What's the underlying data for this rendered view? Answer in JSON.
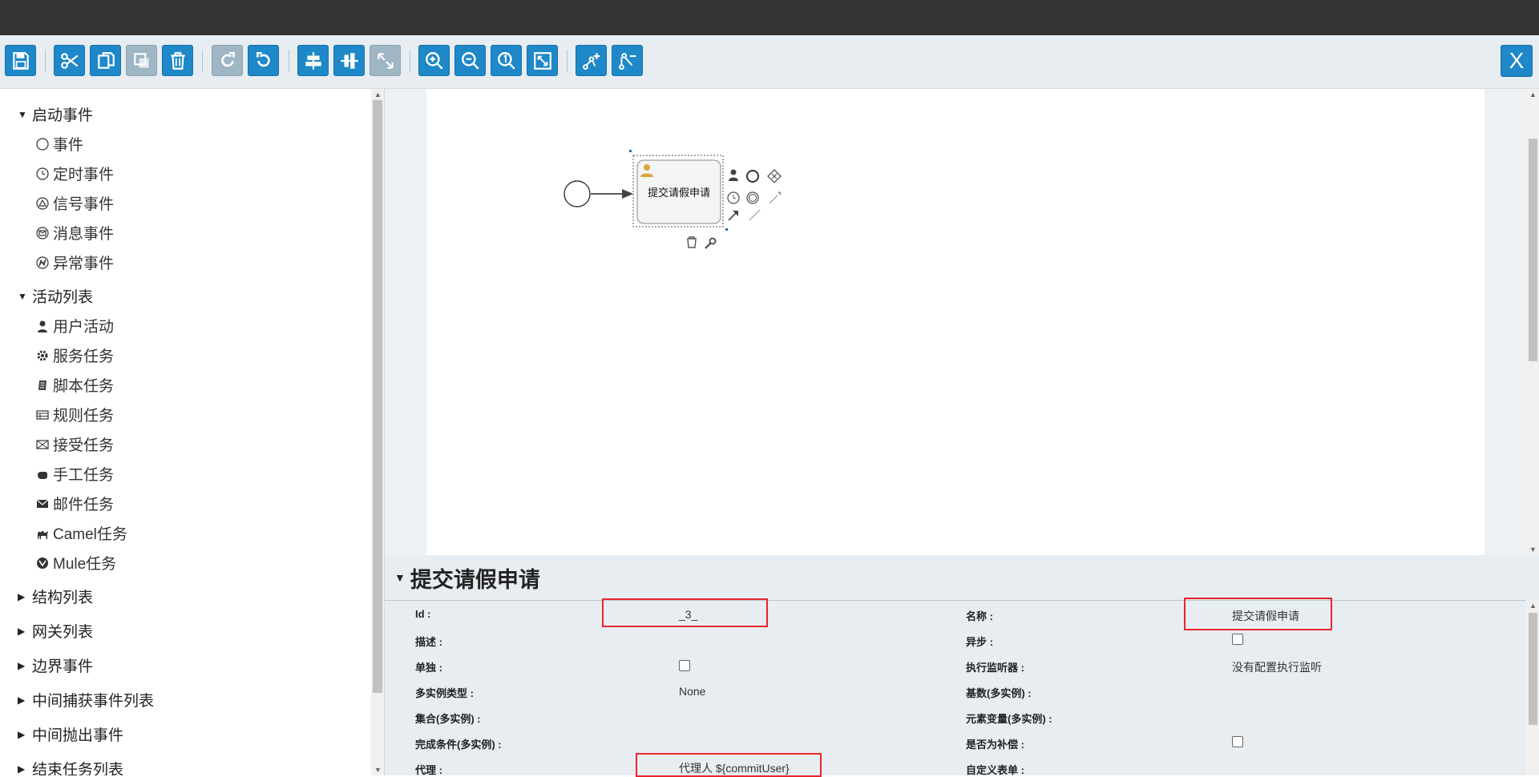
{
  "toolbar": {
    "close_label": "X"
  },
  "palette": {
    "groups": [
      {
        "label": "启动事件",
        "expanded": true,
        "items": [
          {
            "label": "事件",
            "icon": "circle-icon"
          },
          {
            "label": "定时事件",
            "icon": "timer-icon"
          },
          {
            "label": "信号事件",
            "icon": "signal-icon"
          },
          {
            "label": "消息事件",
            "icon": "message-icon"
          },
          {
            "label": "异常事件",
            "icon": "error-icon"
          }
        ]
      },
      {
        "label": "活动列表",
        "expanded": true,
        "items": [
          {
            "label": "用户活动",
            "icon": "user-icon"
          },
          {
            "label": "服务任务",
            "icon": "gear-icon"
          },
          {
            "label": "脚本任务",
            "icon": "script-icon"
          },
          {
            "label": "规则任务",
            "icon": "table-icon"
          },
          {
            "label": "接受任务",
            "icon": "envelope-open-icon"
          },
          {
            "label": "手工任务",
            "icon": "hand-icon"
          },
          {
            "label": "邮件任务",
            "icon": "envelope-icon"
          },
          {
            "label": "Camel任务",
            "icon": "camel-icon"
          },
          {
            "label": "Mule任务",
            "icon": "mule-icon"
          }
        ]
      },
      {
        "label": "结构列表",
        "expanded": false
      },
      {
        "label": "网关列表",
        "expanded": false
      },
      {
        "label": "边界事件",
        "expanded": false
      },
      {
        "label": "中间捕获事件列表",
        "expanded": false
      },
      {
        "label": "中间抛出事件",
        "expanded": false
      },
      {
        "label": "结束任务列表",
        "expanded": false
      }
    ]
  },
  "canvas": {
    "task_label": "提交请假申请"
  },
  "properties": {
    "title": "提交请假申请",
    "left": [
      {
        "label": "Id :",
        "value": "_3_"
      },
      {
        "label": "描述 :",
        "value": ""
      },
      {
        "label": "单独 :",
        "value": ""
      },
      {
        "label": "多实例类型 :",
        "value": "None"
      },
      {
        "label": "集合(多实例) :",
        "value": ""
      },
      {
        "label": "完成条件(多实例) :",
        "value": ""
      },
      {
        "label": "代理 :",
        "value": "代理人 ${commitUser}"
      }
    ],
    "right": [
      {
        "label": "名称 :",
        "value": "提交请假申请"
      },
      {
        "label": "异步 :",
        "value": ""
      },
      {
        "label": "执行监听器 :",
        "value": "没有配置执行监听"
      },
      {
        "label": "基数(多实例) :",
        "value": ""
      },
      {
        "label": "元素变量(多实例) :",
        "value": ""
      },
      {
        "label": "是否为补偿 :",
        "value": ""
      },
      {
        "label": "自定义表单 :",
        "value": ""
      }
    ]
  },
  "colors": {
    "accent": "#1e88c8",
    "highlight": "#e8262b",
    "titlebar": "#333333"
  }
}
